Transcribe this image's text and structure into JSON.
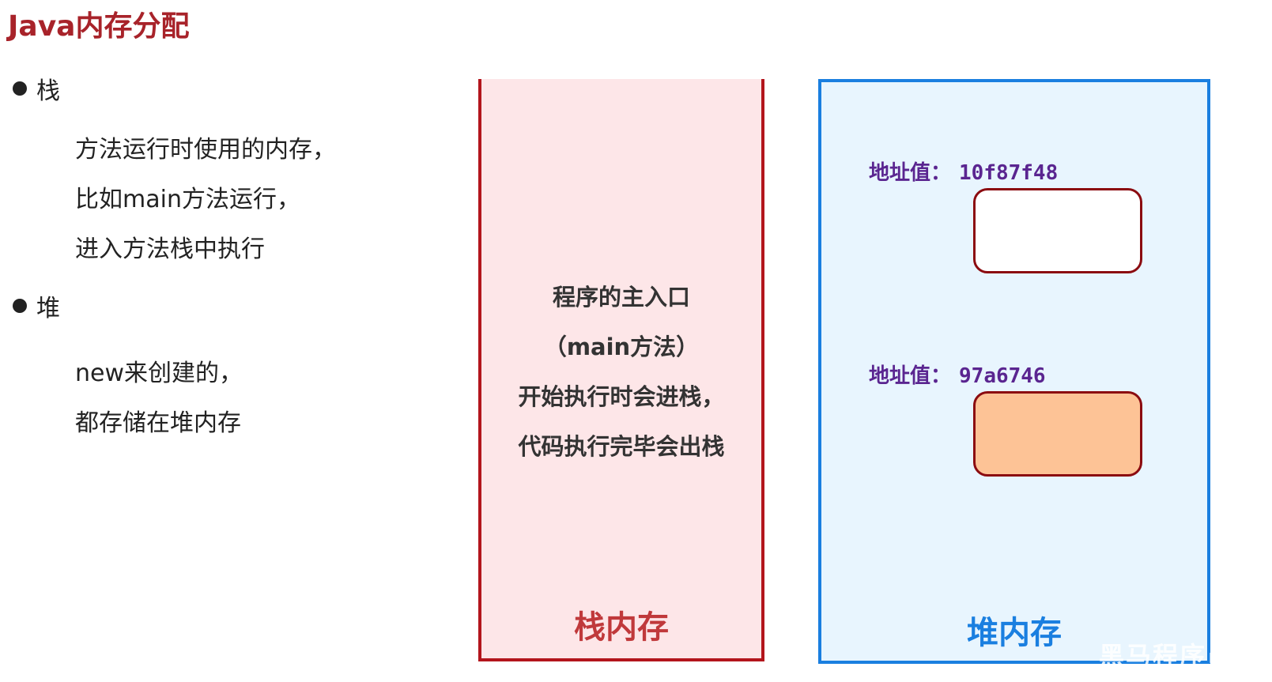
{
  "title": "Java内存分配",
  "left": {
    "stack_bullet": "栈",
    "stack_lines": [
      "方法运行时使用的内存，",
      "比如main方法运行，",
      "进入方法栈中执行"
    ],
    "heap_bullet": "堆",
    "heap_lines": [
      "new来创建的，",
      "都存储在堆内存"
    ]
  },
  "stack": {
    "lines": [
      "程序的主入口",
      "（main方法）",
      "开始执行时会进栈，",
      "代码执行完毕会出栈"
    ],
    "label": "栈内存",
    "border_color": "#b3151c",
    "fill_color": "#fde6e8"
  },
  "heap": {
    "objects": [
      {
        "addr_label": "地址值：",
        "addr": "10f87f48",
        "fill": "#ffffff"
      },
      {
        "addr_label": "地址值：",
        "addr": "97a6746",
        "fill": "#fdc396"
      }
    ],
    "label": "堆内存",
    "border_color": "#1a7fe0",
    "fill_color": "#e8f5fe"
  },
  "watermark": "黑马程序员"
}
